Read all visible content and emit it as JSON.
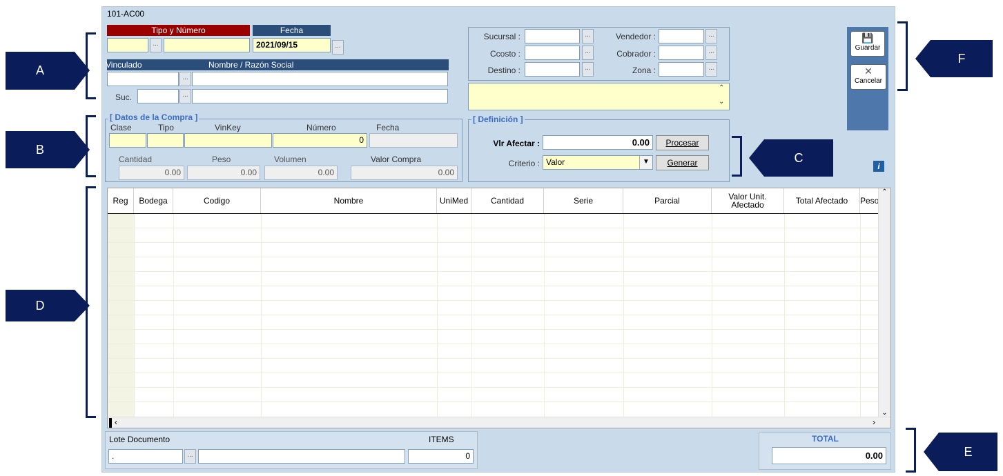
{
  "window": {
    "title": "101-AC00"
  },
  "header": {
    "tipo_numero_label": "Tipo y Número",
    "fecha_label": "Fecha",
    "fecha_value": "2021/09/15",
    "vinculado_label": "Vinculado",
    "nombre_label": "Nombre / Razón Social",
    "suc_label": "Suc."
  },
  "right_fields": {
    "sucursal": "Sucursal :",
    "ccosto": "Ccosto :",
    "destino": "Destino :",
    "vendedor": "Vendedor :",
    "cobrador": "Cobrador :",
    "zona": "Zona :"
  },
  "compra": {
    "title": "[ Datos de la Compra ]",
    "clase": "Clase",
    "tipo": "Tipo",
    "vinkey": "VinKey",
    "numero": "Número",
    "fecha": "Fecha",
    "numero_value": "0",
    "cantidad": "Cantidad",
    "peso": "Peso",
    "volumen": "Volumen",
    "valor_compra": "Valor Compra",
    "cantidad_value": "0.00",
    "peso_value": "0.00",
    "volumen_value": "0.00",
    "valor_compra_value": "0.00"
  },
  "definicion": {
    "title": "[ Definición ]",
    "vlr_afectar": "Vlr Afectar :",
    "vlr_value": "0.00",
    "procesar": "Procesar",
    "criterio": "Criterio :",
    "criterio_value": "Valor",
    "generar": "Generar"
  },
  "actions": {
    "guardar": "Guardar",
    "cancelar": "Cancelar"
  },
  "grid": {
    "columns": [
      "Reg",
      "Bodega",
      "Codigo",
      "Nombre",
      "UniMed",
      "Cantidad",
      "Serie",
      "Parcial",
      "Valor Unit. Afectado",
      "Total  Afectado",
      "Peso"
    ]
  },
  "footer": {
    "lote_label": "Lote Documento",
    "lote_value": ".",
    "items_label": "ITEMS",
    "items_value": "0",
    "total_label": "TOTAL",
    "total_value": "0.00"
  },
  "markers": {
    "a": "A",
    "b": "B",
    "c": "C",
    "d": "D",
    "e": "E",
    "f": "F"
  },
  "colors": {
    "marker": "#0b1c5a",
    "tipo_header": "#9b0000",
    "fecha_header": "#2a4d7a",
    "total": "#3a6cc0"
  }
}
